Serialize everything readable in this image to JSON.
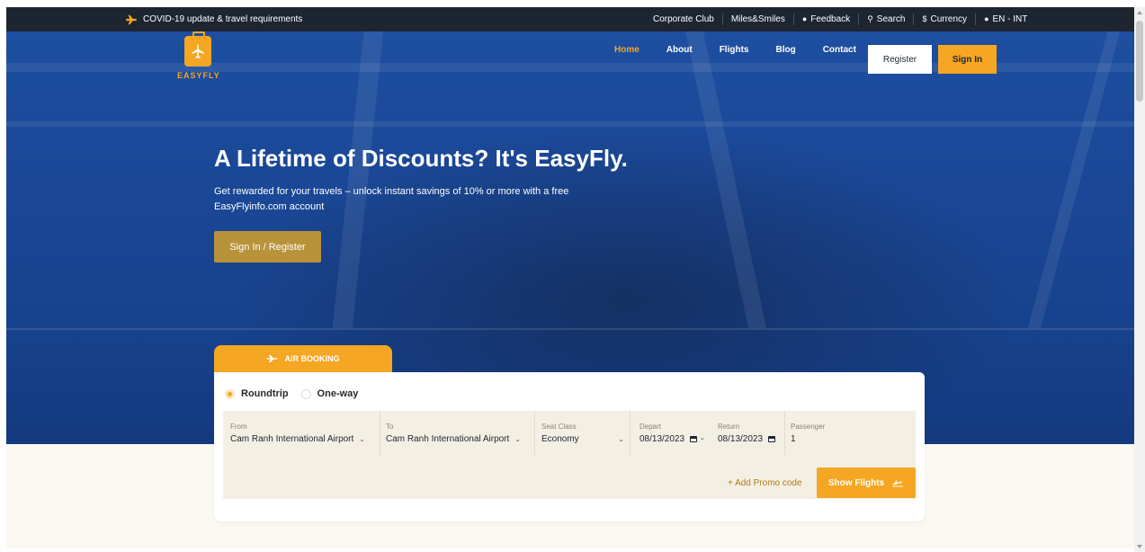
{
  "topbar": {
    "notice": "COVID-19 update & travel requirements",
    "links": [
      {
        "label": "Corporate Club",
        "icon": ""
      },
      {
        "label": "Miles&Smiles",
        "icon": ""
      },
      {
        "label": "Feedback",
        "icon": "chat-icon"
      },
      {
        "label": "Search",
        "icon": "search-icon"
      },
      {
        "label": "Currency",
        "icon": "dollar-icon"
      },
      {
        "label": "EN - INT",
        "icon": "globe-icon"
      }
    ]
  },
  "brand": {
    "name": "EASYFLY",
    "color": "#f5a623"
  },
  "nav": {
    "items": [
      "Home",
      "About",
      "Flights",
      "Blog",
      "Contact"
    ],
    "active": "Home",
    "register_label": "Register",
    "signin_label": "Sign In"
  },
  "hero": {
    "title": "A Lifetime of Discounts? It's EasyFly.",
    "subtitle": "Get rewarded for your travels – unlock instant savings of 10% or more with a free EasyFlyinfo.com account",
    "cta_label": "Sign In / Register"
  },
  "booking": {
    "tab_label": "AIR BOOKING",
    "trip_types": [
      "Roundtrip",
      "One-way"
    ],
    "selected_trip": "Roundtrip",
    "from": {
      "label": "From",
      "value": "Cam Ranh International Airport"
    },
    "to": {
      "label": "To",
      "value": "Cam Ranh International Airport"
    },
    "seat": {
      "label": "Seat Class",
      "value": "Economy"
    },
    "depart": {
      "label": "Depart",
      "value": "08/13/2023"
    },
    "date_separator": "-",
    "return": {
      "label": "Return",
      "value": "08/13/2023"
    },
    "passenger": {
      "label": "Passenger",
      "value": "1"
    },
    "promo_label": "+ Add Promo code",
    "show_flights_label": "Show Flights"
  }
}
